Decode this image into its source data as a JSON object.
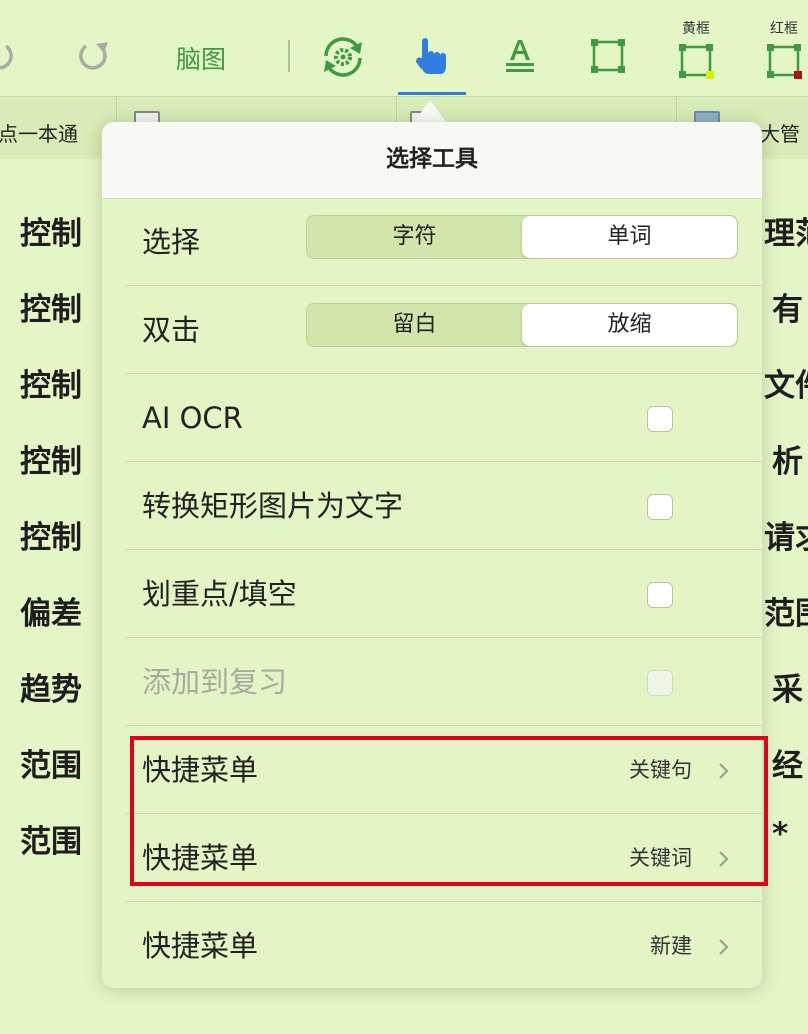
{
  "toolbar": {
    "mindmap_label": "脑图",
    "yellow_frame_label": "黄框",
    "red_frame_label": "红框",
    "accent_color": "#3f9a41",
    "active_tool_color": "#2f7ee0",
    "icons": [
      "undo-icon",
      "redo-icon",
      "sync-gear-icon",
      "hand-pointer-icon",
      "text-underline-icon",
      "rectangle-select-icon",
      "yellow-frame-icon",
      "red-frame-icon"
    ]
  },
  "tabs": [
    {
      "label": "点一本通",
      "icon": "document-icon"
    },
    {
      "label": "",
      "icon": "document-icon"
    },
    {
      "label": "",
      "icon": "document-icon"
    },
    {
      "label": "大管",
      "icon": "document-icon"
    }
  ],
  "background_left": [
    "控制",
    "控制",
    "控制",
    "控制",
    "控制",
    "偏差",
    "趋势",
    "范围",
    "范围"
  ],
  "background_right": [
    "理范",
    "有",
    "文件",
    "析",
    "请求",
    "范围",
    "采",
    "经",
    "*"
  ],
  "popover": {
    "title": "选择工具",
    "rows": [
      {
        "label": "选择",
        "type": "segmented",
        "options": [
          "字符",
          "单词"
        ],
        "selected": "单词"
      },
      {
        "label": "双击",
        "type": "segmented",
        "options": [
          "留白",
          "放缩"
        ],
        "selected": "放缩"
      },
      {
        "label": "AI OCR",
        "type": "checkbox",
        "checked": false
      },
      {
        "label": "转换矩形图片为文字",
        "type": "checkbox",
        "checked": false
      },
      {
        "label": "划重点/填空",
        "type": "checkbox",
        "checked": false
      },
      {
        "label": "添加到复习",
        "type": "checkbox",
        "checked": false,
        "disabled": true
      },
      {
        "label": "快捷菜单",
        "type": "disclosure",
        "value": "关键句"
      },
      {
        "label": "快捷菜单",
        "type": "disclosure",
        "value": "关键词"
      },
      {
        "label": "快捷菜单",
        "type": "disclosure",
        "value": "新建"
      }
    ]
  },
  "highlight_color": "#e4001b"
}
